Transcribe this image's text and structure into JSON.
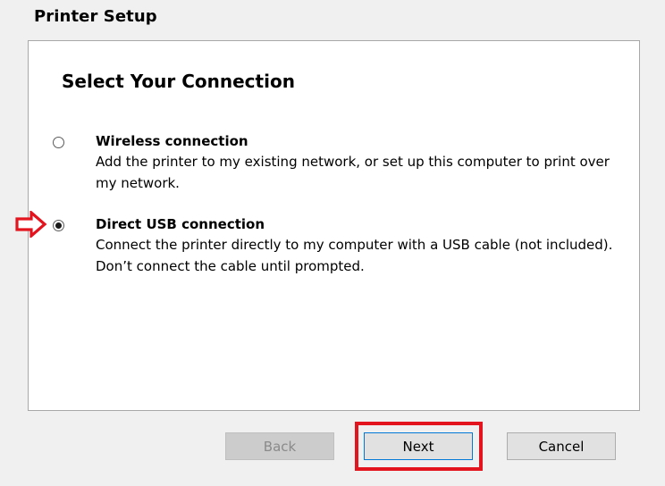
{
  "window": {
    "title": "Printer Setup"
  },
  "panel": {
    "heading": "Select Your Connection"
  },
  "options": [
    {
      "title": "Wireless connection",
      "description": "Add the printer to my existing network, or set up this computer to print over my network.",
      "selected": false
    },
    {
      "title": "Direct USB connection",
      "description": "Connect the printer directly to my computer with a USB cable (not included). Don’t connect the cable until prompted.",
      "selected": true
    }
  ],
  "buttons": {
    "back_label": "Back",
    "back_enabled": false,
    "next_label": "Next",
    "cancel_label": "Cancel"
  },
  "annotations": {
    "arrow_icon": "arrow-right-outline-icon",
    "arrow_color": "#e3141e",
    "highlight_color": "#e3141e"
  },
  "colors": {
    "background": "#f0f0f0",
    "panel": "#ffffff",
    "focus_border": "#0078d7"
  }
}
